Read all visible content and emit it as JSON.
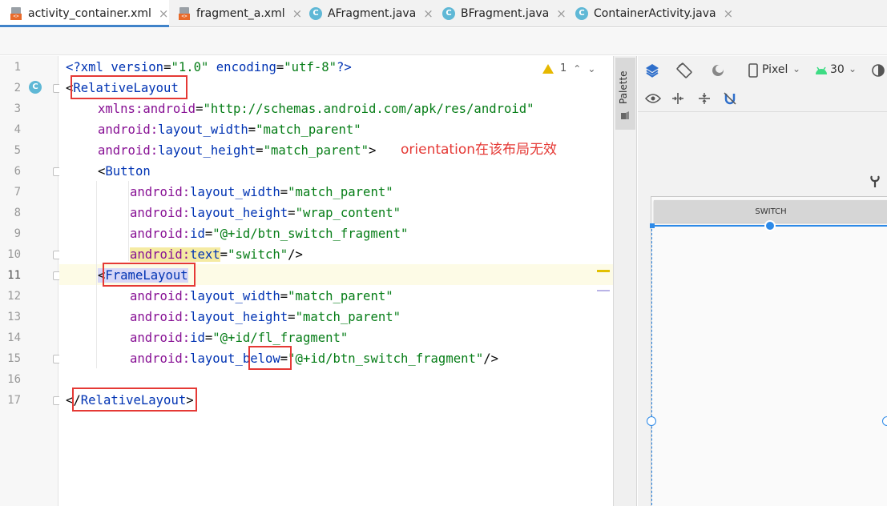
{
  "tabs": [
    {
      "label": "activity_container.xml",
      "icon": "xml-file-icon",
      "active": true
    },
    {
      "label": "fragment_a.xml",
      "icon": "xml-file-icon",
      "active": false
    },
    {
      "label": "AFragment.java",
      "icon": "java-class-icon",
      "active": false
    },
    {
      "label": "BFragment.java",
      "icon": "java-class-icon",
      "active": false
    },
    {
      "label": "ContainerActivity.java",
      "icon": "java-class-icon",
      "active": false
    }
  ],
  "tab_close_glyph": "×",
  "class_glyph": "C",
  "inspector": {
    "warning_count": "1"
  },
  "line_numbers": [
    "1",
    "2",
    "3",
    "4",
    "5",
    "6",
    "7",
    "8",
    "9",
    "10",
    "11",
    "12",
    "13",
    "14",
    "15",
    "16",
    "17"
  ],
  "code": {
    "l1": {
      "pi_open": "<?",
      "pi_name": "xml ",
      "k1": "version",
      "eq": "=",
      "v1": "\"1.0\"",
      "k2": "encoding",
      "v2": "\"utf-8\"",
      "pi_close": "?>"
    },
    "l2": {
      "open": "<",
      "tag": "RelativeLayout"
    },
    "l3": {
      "attr": "xmlns:android",
      "eq": "=",
      "val": "\"http://schemas.android.com/apk/res/android\""
    },
    "l4": {
      "ns": "android:",
      "attr": "layout_width",
      "eq": "=",
      "val": "\"match_parent\""
    },
    "l5": {
      "ns": "android:",
      "attr": "layout_height",
      "eq": "=",
      "val": "\"match_parent\"",
      "close": ">"
    },
    "l6": {
      "open": "<",
      "tag": "Button"
    },
    "l7": {
      "ns": "android:",
      "attr": "layout_width",
      "eq": "=",
      "val": "\"match_parent\""
    },
    "l8": {
      "ns": "android:",
      "attr": "layout_height",
      "eq": "=",
      "val": "\"wrap_content\""
    },
    "l9": {
      "ns": "android:",
      "attr": "id",
      "eq": "=",
      "val": "\"@+id/btn_switch_fragment\""
    },
    "l10": {
      "ns": "android:",
      "attr": "text",
      "eq": "=",
      "val": "\"switch\"",
      "close": "/>"
    },
    "l11": {
      "open": "<",
      "tag": "FrameLayout"
    },
    "l12": {
      "ns": "android:",
      "attr": "layout_width",
      "eq": "=",
      "val": "\"match_parent\""
    },
    "l13": {
      "ns": "android:",
      "attr": "layout_height",
      "eq": "=",
      "val": "\"match_parent\""
    },
    "l14": {
      "ns": "android:",
      "attr": "id",
      "eq": "=",
      "val": "\"@+id/fl_fragment\""
    },
    "l15": {
      "ns": "android:",
      "attr1": "layout_",
      "attr2": "below",
      "eq": "=",
      "val": "\"@+id/btn_switch_fragment\"",
      "close": "/>"
    },
    "l17": {
      "open": "</",
      "tag": "RelativeLayout",
      "close": ">"
    }
  },
  "annotation": "orientation在该布局无效",
  "palette_label": "Palette",
  "design": {
    "device": "Pixel",
    "api_level": "30",
    "preview_button": "SWITCH"
  },
  "colors": {
    "tag": "#0033b3",
    "attribute": "#871094",
    "value": "#067d17",
    "annotation": "#e53935",
    "selection": "#2d8ae8",
    "active_tab_underline": "#4083c9"
  }
}
